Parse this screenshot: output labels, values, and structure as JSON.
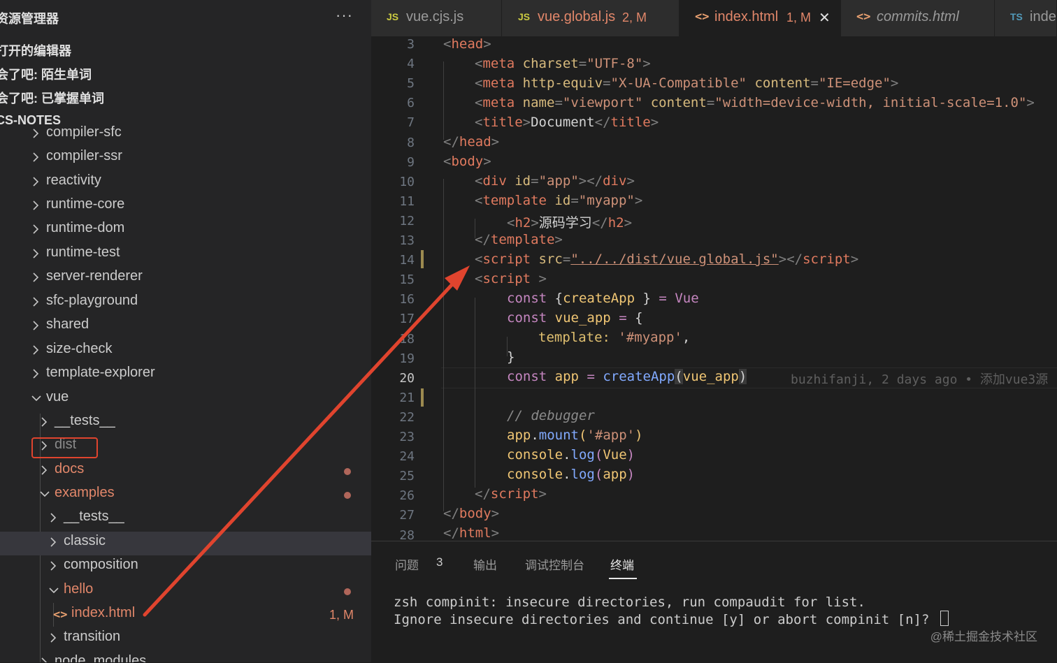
{
  "sidebar": {
    "title": "资源管理器",
    "more_label": "···",
    "sections": [
      "打开的编辑器",
      "会了吧: 陌生单词",
      "会了吧: 已掌握单词",
      "CS-NOTES"
    ],
    "tree": [
      {
        "label": "compiler-sfc",
        "expanded": false
      },
      {
        "label": "compiler-ssr",
        "expanded": false
      },
      {
        "label": "reactivity",
        "expanded": false
      },
      {
        "label": "runtime-core",
        "expanded": false
      },
      {
        "label": "runtime-dom",
        "expanded": false
      },
      {
        "label": "runtime-test",
        "expanded": false
      },
      {
        "label": "server-renderer",
        "expanded": false
      },
      {
        "label": "sfc-playground",
        "expanded": false
      },
      {
        "label": "shared",
        "expanded": false
      },
      {
        "label": "size-check",
        "expanded": false
      },
      {
        "label": "template-explorer",
        "expanded": false
      },
      {
        "label": "vue",
        "expanded": true
      },
      {
        "label": "__tests__",
        "expanded": false
      },
      {
        "label": "dist",
        "expanded": false
      },
      {
        "label": "docs",
        "expanded": false
      },
      {
        "label": "examples",
        "expanded": true
      },
      {
        "label": "__tests__",
        "expanded": false
      },
      {
        "label": "classic",
        "expanded": false
      },
      {
        "label": "composition",
        "expanded": false
      },
      {
        "label": "hello",
        "expanded": true
      },
      {
        "label": "index.html",
        "badge": "1, M"
      },
      {
        "label": "transition",
        "expanded": false
      },
      {
        "label": "node_modules",
        "expanded": false
      }
    ]
  },
  "tabs": [
    {
      "icon": "JS",
      "label": "vue.cjs.js"
    },
    {
      "icon": "JS",
      "label": "vue.global.js",
      "badge": "2, M"
    },
    {
      "icon": "<>",
      "label": "index.html",
      "badge": "1, M",
      "active": true
    },
    {
      "icon": "<>",
      "label": "commits.html"
    },
    {
      "icon": "TS",
      "label": "inde"
    }
  ],
  "editor": {
    "line_numbers": [
      "3",
      "4",
      "5",
      "6",
      "7",
      "8",
      "9",
      "10",
      "11",
      "12",
      "13",
      "14",
      "15",
      "16",
      "17",
      "18",
      "19",
      "20",
      "21",
      "22",
      "23",
      "24",
      "25",
      "26",
      "27",
      "28"
    ],
    "current_line": "20",
    "blame": "buzhifanji, 2 days ago • 添加vue3源",
    "code": {
      "l3": {
        "tag": "head"
      },
      "l4": {
        "tag": "meta",
        "attr": "charset",
        "val": "\"UTF-8\""
      },
      "l5": {
        "tag": "meta",
        "attr1": "http-equiv",
        "val1": "\"X-UA-Compatible\"",
        "attr2": "content",
        "val2": "\"IE=edge\""
      },
      "l6": {
        "tag": "meta",
        "attr1": "name",
        "val1": "\"viewport\"",
        "attr2": "content",
        "val2": "\"width=device-width, initial-scale=1.0\""
      },
      "l7": {
        "tag": "title",
        "text": "Document"
      },
      "l8": {
        "tag": "head"
      },
      "l9": {
        "tag": "body"
      },
      "l10": {
        "tag": "div",
        "attr": "id",
        "val": "\"app\""
      },
      "l11": {
        "tag": "template",
        "attr": "id",
        "val": "\"myapp\""
      },
      "l12": {
        "tag": "h2",
        "text": "源码学习"
      },
      "l13": {
        "tag": "template"
      },
      "l14": {
        "tag": "script",
        "attr": "src",
        "val": "\"../../dist/vue.global.js\""
      },
      "l15": {
        "tag": "script"
      },
      "l16": {
        "kw": "const",
        "open": "{",
        "name": "createApp",
        "close": "}",
        "eq": "=",
        "rhs": "Vue"
      },
      "l17": {
        "kw": "const",
        "name": "vue_app",
        "eq": "=",
        "open": "{"
      },
      "l18": {
        "prop": "template:",
        "val": "'#myapp'",
        "comma": ","
      },
      "l19": {
        "close": "}"
      },
      "l20": {
        "kw": "const",
        "name": "app",
        "eq": "=",
        "fn": "createApp",
        "arg": "vue_app"
      },
      "l22": {
        "comment": "// debugger"
      },
      "l23": {
        "obj": "app",
        "method": "mount",
        "arg": "'#app'"
      },
      "l24": {
        "obj": "console",
        "method": "log",
        "arg": "Vue"
      },
      "l25": {
        "obj": "console",
        "method": "log",
        "arg": "app"
      },
      "l26": {
        "tag": "script"
      },
      "l27": {
        "tag": "body"
      },
      "l28": {
        "tag": "html"
      }
    }
  },
  "panel": {
    "tabs": [
      "问题",
      "输出",
      "调试控制台",
      "终端"
    ],
    "problems_count": "3",
    "active_tab": "终端",
    "terminal": [
      "zsh compinit: insecure directories, run compaudit for list.",
      "Ignore insecure directories and continue [y] or abort compinit [n]? "
    ]
  },
  "watermark": "@稀土掘金技术社区",
  "colors": {
    "annotation": "#e0442e",
    "modified": "#e2876a",
    "tag": "#e07a5f"
  }
}
